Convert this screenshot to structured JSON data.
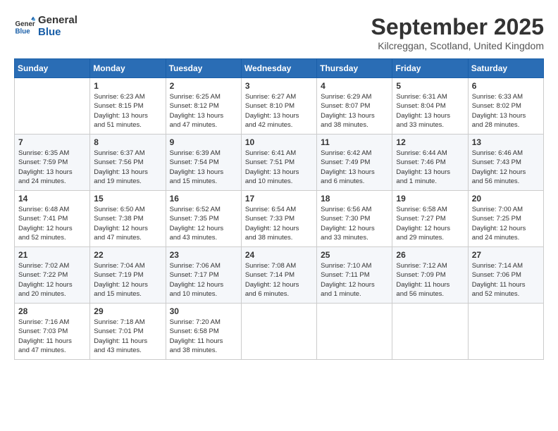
{
  "header": {
    "logo_line1": "General",
    "logo_line2": "Blue",
    "month": "September 2025",
    "location": "Kilcreggan, Scotland, United Kingdom"
  },
  "weekdays": [
    "Sunday",
    "Monday",
    "Tuesday",
    "Wednesday",
    "Thursday",
    "Friday",
    "Saturday"
  ],
  "weeks": [
    [
      {
        "day": "",
        "info": ""
      },
      {
        "day": "1",
        "info": "Sunrise: 6:23 AM\nSunset: 8:15 PM\nDaylight: 13 hours\nand 51 minutes."
      },
      {
        "day": "2",
        "info": "Sunrise: 6:25 AM\nSunset: 8:12 PM\nDaylight: 13 hours\nand 47 minutes."
      },
      {
        "day": "3",
        "info": "Sunrise: 6:27 AM\nSunset: 8:10 PM\nDaylight: 13 hours\nand 42 minutes."
      },
      {
        "day": "4",
        "info": "Sunrise: 6:29 AM\nSunset: 8:07 PM\nDaylight: 13 hours\nand 38 minutes."
      },
      {
        "day": "5",
        "info": "Sunrise: 6:31 AM\nSunset: 8:04 PM\nDaylight: 13 hours\nand 33 minutes."
      },
      {
        "day": "6",
        "info": "Sunrise: 6:33 AM\nSunset: 8:02 PM\nDaylight: 13 hours\nand 28 minutes."
      }
    ],
    [
      {
        "day": "7",
        "info": "Sunrise: 6:35 AM\nSunset: 7:59 PM\nDaylight: 13 hours\nand 24 minutes."
      },
      {
        "day": "8",
        "info": "Sunrise: 6:37 AM\nSunset: 7:56 PM\nDaylight: 13 hours\nand 19 minutes."
      },
      {
        "day": "9",
        "info": "Sunrise: 6:39 AM\nSunset: 7:54 PM\nDaylight: 13 hours\nand 15 minutes."
      },
      {
        "day": "10",
        "info": "Sunrise: 6:41 AM\nSunset: 7:51 PM\nDaylight: 13 hours\nand 10 minutes."
      },
      {
        "day": "11",
        "info": "Sunrise: 6:42 AM\nSunset: 7:49 PM\nDaylight: 13 hours\nand 6 minutes."
      },
      {
        "day": "12",
        "info": "Sunrise: 6:44 AM\nSunset: 7:46 PM\nDaylight: 13 hours\nand 1 minute."
      },
      {
        "day": "13",
        "info": "Sunrise: 6:46 AM\nSunset: 7:43 PM\nDaylight: 12 hours\nand 56 minutes."
      }
    ],
    [
      {
        "day": "14",
        "info": "Sunrise: 6:48 AM\nSunset: 7:41 PM\nDaylight: 12 hours\nand 52 minutes."
      },
      {
        "day": "15",
        "info": "Sunrise: 6:50 AM\nSunset: 7:38 PM\nDaylight: 12 hours\nand 47 minutes."
      },
      {
        "day": "16",
        "info": "Sunrise: 6:52 AM\nSunset: 7:35 PM\nDaylight: 12 hours\nand 43 minutes."
      },
      {
        "day": "17",
        "info": "Sunrise: 6:54 AM\nSunset: 7:33 PM\nDaylight: 12 hours\nand 38 minutes."
      },
      {
        "day": "18",
        "info": "Sunrise: 6:56 AM\nSunset: 7:30 PM\nDaylight: 12 hours\nand 33 minutes."
      },
      {
        "day": "19",
        "info": "Sunrise: 6:58 AM\nSunset: 7:27 PM\nDaylight: 12 hours\nand 29 minutes."
      },
      {
        "day": "20",
        "info": "Sunrise: 7:00 AM\nSunset: 7:25 PM\nDaylight: 12 hours\nand 24 minutes."
      }
    ],
    [
      {
        "day": "21",
        "info": "Sunrise: 7:02 AM\nSunset: 7:22 PM\nDaylight: 12 hours\nand 20 minutes."
      },
      {
        "day": "22",
        "info": "Sunrise: 7:04 AM\nSunset: 7:19 PM\nDaylight: 12 hours\nand 15 minutes."
      },
      {
        "day": "23",
        "info": "Sunrise: 7:06 AM\nSunset: 7:17 PM\nDaylight: 12 hours\nand 10 minutes."
      },
      {
        "day": "24",
        "info": "Sunrise: 7:08 AM\nSunset: 7:14 PM\nDaylight: 12 hours\nand 6 minutes."
      },
      {
        "day": "25",
        "info": "Sunrise: 7:10 AM\nSunset: 7:11 PM\nDaylight: 12 hours\nand 1 minute."
      },
      {
        "day": "26",
        "info": "Sunrise: 7:12 AM\nSunset: 7:09 PM\nDaylight: 11 hours\nand 56 minutes."
      },
      {
        "day": "27",
        "info": "Sunrise: 7:14 AM\nSunset: 7:06 PM\nDaylight: 11 hours\nand 52 minutes."
      }
    ],
    [
      {
        "day": "28",
        "info": "Sunrise: 7:16 AM\nSunset: 7:03 PM\nDaylight: 11 hours\nand 47 minutes."
      },
      {
        "day": "29",
        "info": "Sunrise: 7:18 AM\nSunset: 7:01 PM\nDaylight: 11 hours\nand 43 minutes."
      },
      {
        "day": "30",
        "info": "Sunrise: 7:20 AM\nSunset: 6:58 PM\nDaylight: 11 hours\nand 38 minutes."
      },
      {
        "day": "",
        "info": ""
      },
      {
        "day": "",
        "info": ""
      },
      {
        "day": "",
        "info": ""
      },
      {
        "day": "",
        "info": ""
      }
    ]
  ]
}
